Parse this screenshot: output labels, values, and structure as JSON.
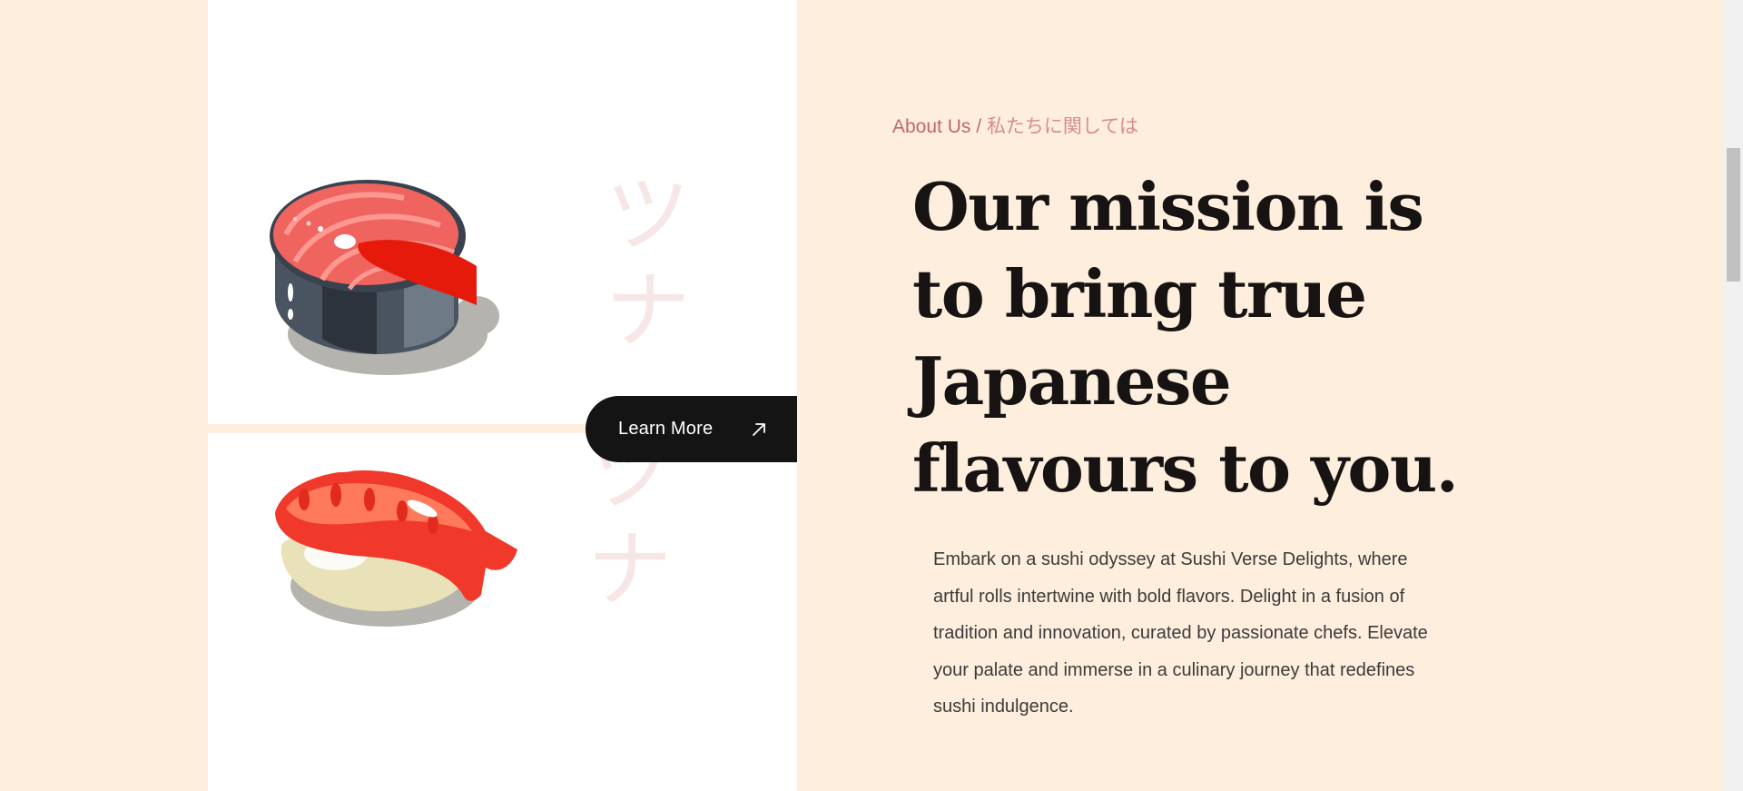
{
  "hero": {
    "kana_top": "ツナ",
    "kana_bottom": "ツナ",
    "learn_more_label": "Learn More",
    "images": {
      "top": "salmon-steak-illustration",
      "bottom": "shrimp-nigiri-illustration"
    }
  },
  "about": {
    "eyebrow": "About Us /",
    "eyebrow_jp": "私たちに関しては",
    "headline": "Our mission is to bring true Japanese flavours to you.",
    "description": "Embark on a sushi odyssey at Sushi Verse Delights, where artful rolls intertwine with bold flavors. Delight in a fusion of tradition and innovation, curated by passionate chefs. Elevate your palate and immerse in a culinary journey that redefines sushi indulgence."
  },
  "colors": {
    "background": "#fdeedd",
    "panel": "#ffffff",
    "button": "#141414",
    "eyebrow": "#c2666e",
    "headline": "#161312",
    "body": "#3c3b3a"
  }
}
